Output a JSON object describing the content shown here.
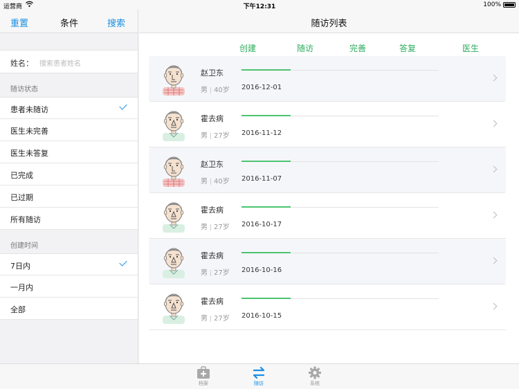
{
  "status_bar": {
    "carrier": "运营商",
    "time": "下午12:31",
    "battery": "100%"
  },
  "left": {
    "reset_label": "重置",
    "title": "条件",
    "search_label": "搜索",
    "name_label": "姓名：",
    "name_placeholder": "搜索患者姓名",
    "status_section": "随访状态",
    "status_options": [
      "患者未随访",
      "医生未完善",
      "医生未答复",
      "已完成",
      "已过期",
      "所有随访"
    ],
    "time_section": "创建时间",
    "time_options": [
      "7日内",
      "一月内",
      "全部"
    ]
  },
  "right": {
    "title": "随访列表",
    "columns": [
      "创建",
      "随访",
      "完善",
      "答复",
      "医生"
    ],
    "rows": [
      {
        "name": "赵卫东",
        "gender": "男",
        "age": "40岁",
        "date": "2016-12-01",
        "avatar": "plaid",
        "progress": 0.25
      },
      {
        "name": "霍去病",
        "gender": "男",
        "age": "27岁",
        "date": "2016-11-12",
        "avatar": "plain",
        "progress": 0.25
      },
      {
        "name": "赵卫东",
        "gender": "男",
        "age": "40岁",
        "date": "2016-11-07",
        "avatar": "plaid",
        "progress": 0.25
      },
      {
        "name": "霍去病",
        "gender": "男",
        "age": "27岁",
        "date": "2016-10-17",
        "avatar": "plain",
        "progress": 0.25
      },
      {
        "name": "霍去病",
        "gender": "男",
        "age": "27岁",
        "date": "2016-10-16",
        "avatar": "plain",
        "progress": 0.25
      },
      {
        "name": "霍去病",
        "gender": "男",
        "age": "27岁",
        "date": "2016-10-15",
        "avatar": "plain",
        "progress": 0.25
      }
    ]
  },
  "tabs": [
    {
      "label": "档案",
      "icon": "medical-kit-icon",
      "active": false
    },
    {
      "label": "随访",
      "icon": "swap-arrows-icon",
      "active": true
    },
    {
      "label": "系统",
      "icon": "gear-icon",
      "active": false
    }
  ],
  "colors": {
    "accent": "#1a8fe3",
    "progress": "#4cc470",
    "column_header": "#2fad5f"
  }
}
